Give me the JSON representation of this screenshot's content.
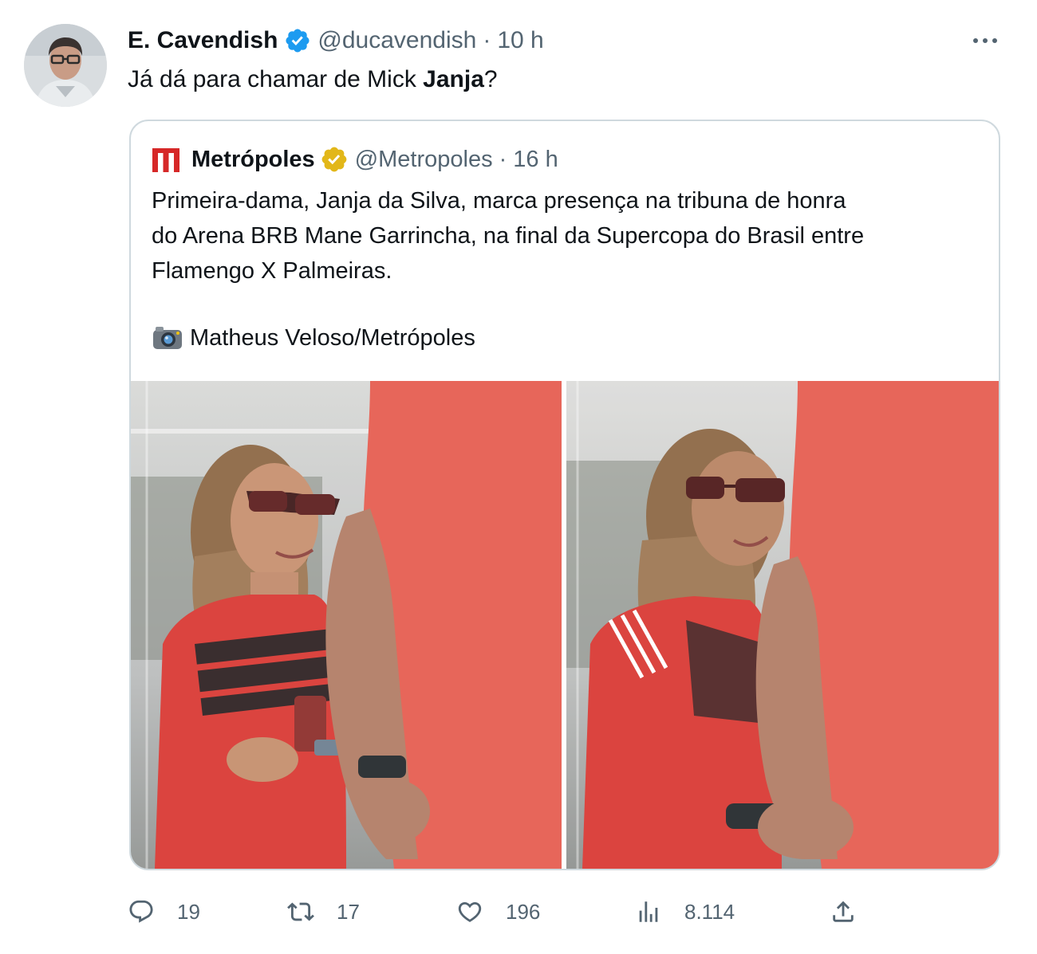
{
  "tweet": {
    "author_name": "E. Cavendish",
    "author_handle": "@ducavendish",
    "separator": "·",
    "time": "10 h",
    "text_before": "Já dá para chamar de Mick ",
    "text_bold": "Janja",
    "text_after": "?",
    "avatar_icon": "avatar-photo",
    "more_icon": "more-horizontal-icon"
  },
  "quote": {
    "author_name": "Metrópoles",
    "author_handle": "@Metropoles",
    "separator": "·",
    "time": "16 h",
    "logo_icon": "metropoles-logo",
    "brand_color": "#d62828",
    "gold_badge_color": "#e2b719",
    "body_lines": [
      "Primeira-dama, Janja da Silva, marca presença na tribuna de honra",
      "do Arena BRB Mane Garrincha, na final da Supercopa do Brasil entre",
      "Flamengo X Palmeiras."
    ],
    "credit_icon": "camera-icon",
    "credit": "Matheus Veloso/Metrópoles"
  },
  "actions": {
    "replies": "19",
    "retweets": "17",
    "likes": "196",
    "views": "8.114",
    "reply_icon": "reply-icon",
    "retweet_icon": "retweet-icon",
    "like_icon": "heart-icon",
    "views_icon": "views-icon",
    "share_icon": "share-icon"
  },
  "colors": {
    "text": "#0f1419",
    "secondary": "#536471",
    "verified_blue": "#1d9bf0",
    "border": "#cfd9de",
    "jersey_red": "#d8352f",
    "shirt_red": "#e55a4c"
  }
}
